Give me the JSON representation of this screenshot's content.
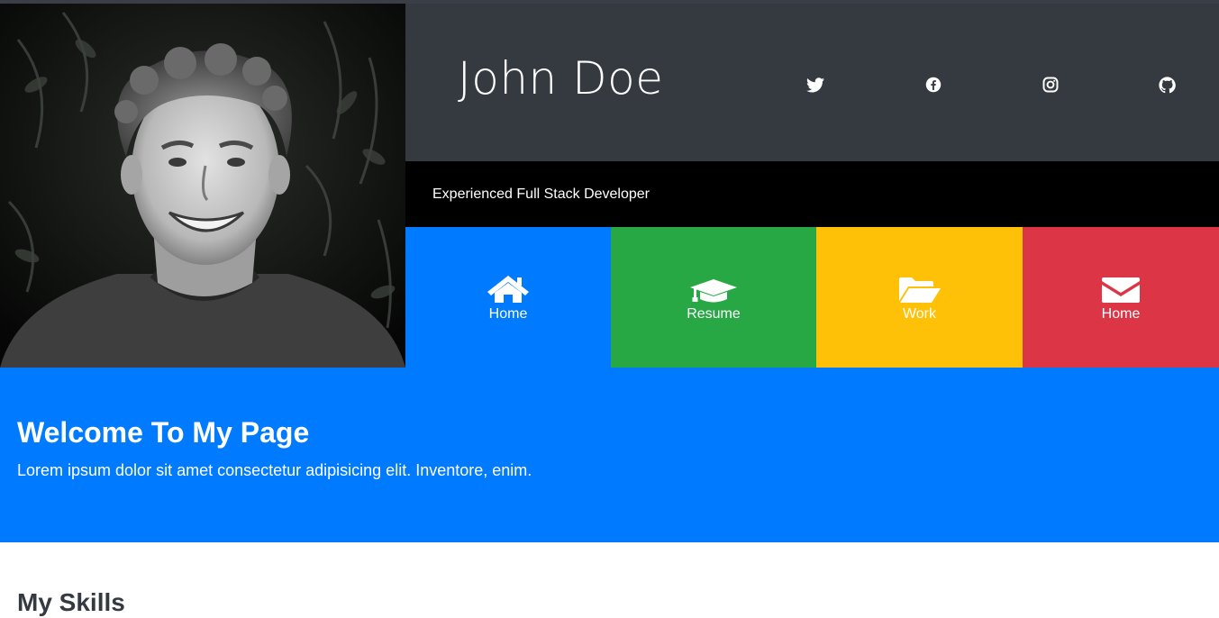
{
  "header": {
    "name": "John Doe",
    "tagline": "Experienced Full Stack Developer"
  },
  "photo": {
    "description_icon": "profile-photo"
  },
  "social": [
    {
      "icon": "twitter-icon"
    },
    {
      "icon": "facebook-icon"
    },
    {
      "icon": "instagram-icon"
    },
    {
      "icon": "github-icon"
    }
  ],
  "nav": {
    "home": {
      "label": "Home",
      "icon": "home-icon",
      "color": "#007bff"
    },
    "resume": {
      "label": "Resume",
      "icon": "graduation-cap-icon",
      "color": "#28a745"
    },
    "work": {
      "label": "Work",
      "icon": "folder-open-icon",
      "color": "#ffc107"
    },
    "contact": {
      "label": "Home",
      "icon": "envelope-icon",
      "color": "#dc3545"
    }
  },
  "welcome": {
    "title": "Welcome To My Page",
    "text": "Lorem ipsum dolor sit amet consectetur adipisicing elit. Inventore, enim."
  },
  "skills": {
    "title": "My Skills"
  },
  "colors": {
    "header_bg": "#343a40",
    "tagline_bg": "#000000",
    "welcome_bg": "#007bff"
  }
}
